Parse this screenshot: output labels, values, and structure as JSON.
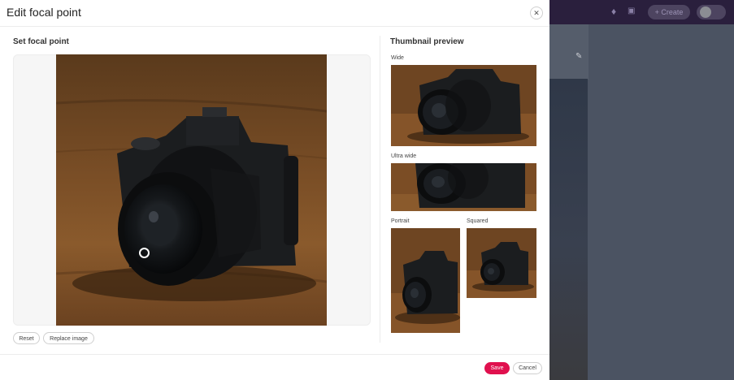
{
  "modal": {
    "title": "Edit focal point",
    "close_icon": "close-icon",
    "set_focal_title": "Set focal point",
    "thumbnail_title": "Thumbnail preview",
    "reset_label": "Reset",
    "replace_label": "Replace image",
    "save_label": "Save",
    "cancel_label": "Cancel",
    "accent_color": "#e0104e"
  },
  "thumbnails": [
    {
      "key": "wide",
      "label": "Wide"
    },
    {
      "key": "ultrawide",
      "label": "Ultra wide"
    },
    {
      "key": "portrait",
      "label": "Portrait"
    },
    {
      "key": "squared",
      "label": "Squared"
    }
  ],
  "background_app": {
    "create_label": "+ Create",
    "icons": [
      "bell-icon",
      "gift-icon",
      "avatar",
      "pencil-icon"
    ]
  }
}
